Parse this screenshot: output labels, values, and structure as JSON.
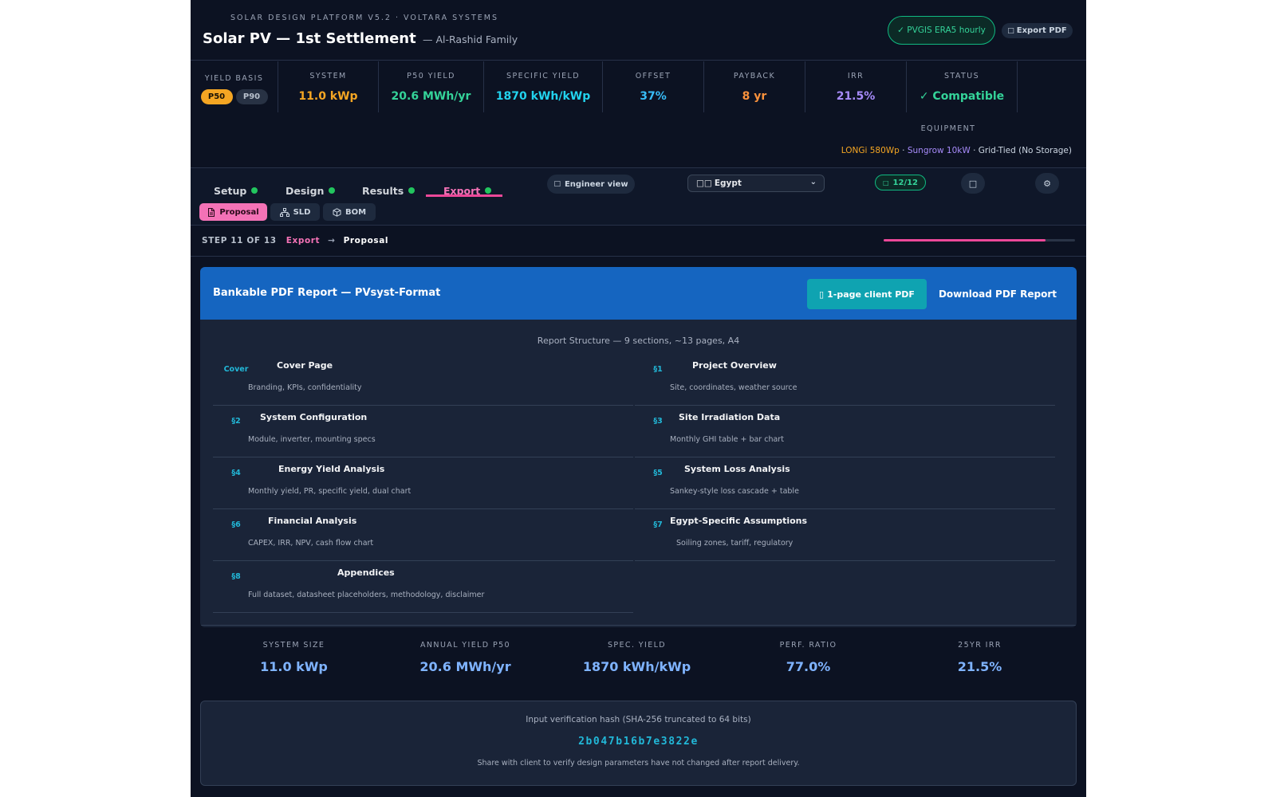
{
  "header": {
    "brand": "SOLAR DESIGN PLATFORM V5.2 · VOLTARA SYSTEMS",
    "title": "Solar PV — 1st Settlement",
    "client": "— Al-Rashid Family",
    "data_source": "✓ PVGIS ERA5 hourly",
    "export_pdf": "Export PDF"
  },
  "kpis": {
    "yield_basis": {
      "label": "YIELD BASIS",
      "options": [
        "P50",
        "P90"
      ],
      "selected": "P50"
    },
    "system": {
      "label": "SYSTEM",
      "value": "11.0 kWp"
    },
    "p50_yield": {
      "label": "P50 YIELD",
      "value": "20.6 MWh/yr"
    },
    "specific_yield": {
      "label": "SPECIFIC YIELD",
      "value": "1870 kWh/kWp"
    },
    "offset": {
      "label": "OFFSET",
      "value": "37%"
    },
    "payback": {
      "label": "PAYBACK",
      "value": "8 yr"
    },
    "irr": {
      "label": "IRR",
      "value": "21.5%"
    },
    "status": {
      "label": "STATUS",
      "value": "✓ Compatible"
    },
    "equipment": {
      "label": "EQUIPMENT",
      "module": "LONGi 580Wp",
      "sep1": " · ",
      "inverter": "Sungrow 10kW",
      "sep2": " · ",
      "type": "Grid-Tied (No Storage)"
    }
  },
  "colors": {
    "system": "#f5a623",
    "p50_yield": "#34d399",
    "specific_yield": "#22d3ee",
    "offset": "#38bdf8",
    "payback": "#fb923c",
    "irr": "#a78bfa",
    "status": "#34d399",
    "accent": "#ec4899",
    "report_header": "#1565c0"
  },
  "tabs": [
    {
      "label": "Setup",
      "done": true
    },
    {
      "label": "Design",
      "done": true
    },
    {
      "label": "Results",
      "done": true
    },
    {
      "label": "Export",
      "done": true,
      "active": true
    }
  ],
  "toolbar": {
    "engineer_view": "Engineer view",
    "country": "Egypt",
    "country_flag": "□□",
    "progress": "12/12"
  },
  "subtabs": [
    {
      "label": "Proposal",
      "icon": "document-icon",
      "active": true
    },
    {
      "label": "SLD",
      "icon": "hierarchy-icon"
    },
    {
      "label": "BOM",
      "icon": "box-icon"
    }
  ],
  "step": {
    "counter": "STEP 11 OF 13",
    "section": "Export",
    "arrow": "→",
    "page": "Proposal",
    "current": 11,
    "total": 13
  },
  "report": {
    "title": "Bankable PDF Report — PVsyst-Format",
    "client_pdf": "1-page client PDF",
    "download": "Download PDF Report",
    "structure_title": "Report Structure — 9 sections, ~13 pages, A4",
    "sections": [
      {
        "num": "Cover",
        "title": "Cover Page",
        "desc": "Branding, KPIs, confidentiality"
      },
      {
        "num": "§1",
        "title": "Project Overview",
        "desc": "Site, coordinates, weather source"
      },
      {
        "num": "§2",
        "title": "System Configuration",
        "desc": "Module, inverter, mounting specs"
      },
      {
        "num": "§3",
        "title": "Site Irradiation Data",
        "desc": "Monthly GHI table + bar chart"
      },
      {
        "num": "§4",
        "title": "Energy Yield Analysis",
        "desc": "Monthly yield, PR, specific yield, dual chart"
      },
      {
        "num": "§5",
        "title": "System Loss Analysis",
        "desc": "Sankey-style loss cascade + table"
      },
      {
        "num": "§6",
        "title": "Financial Analysis",
        "desc": "CAPEX, IRR, NPV, cash flow chart"
      },
      {
        "num": "§7",
        "title": "Egypt-Specific Assumptions",
        "desc": "Soiling zones, tariff, regulatory"
      },
      {
        "num": "§8",
        "title": "Appendices",
        "desc": "Full dataset, datasheet placeholders, methodology, disclaimer"
      }
    ]
  },
  "summary": [
    {
      "label": "SYSTEM SIZE",
      "value": "11.0 kWp"
    },
    {
      "label": "ANNUAL YIELD P50",
      "value": "20.6 MWh/yr"
    },
    {
      "label": "SPEC. YIELD",
      "value": "1870 kWh/kWp"
    },
    {
      "label": "PERF. RATIO",
      "value": "77.0%"
    },
    {
      "label": "25YR IRR",
      "value": "21.5%"
    }
  ],
  "hash": {
    "label": "Input verification hash (SHA-256 truncated to 64 bits)",
    "value": "2b047b16b7e3822e",
    "note": "Share with client to verify design parameters have not changed after report delivery."
  }
}
